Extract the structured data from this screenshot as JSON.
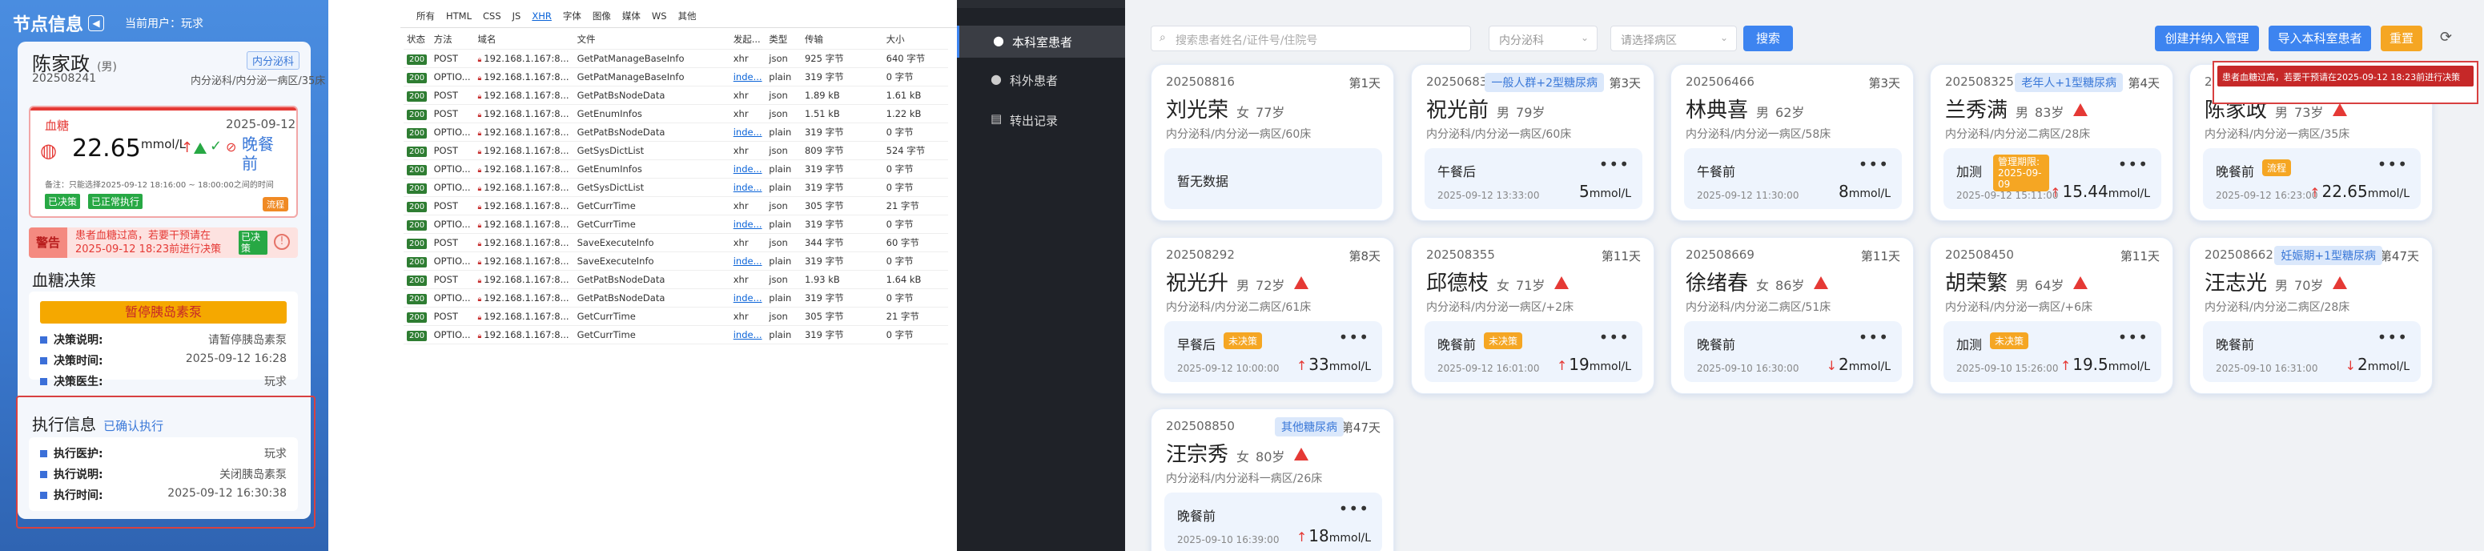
{
  "panelA": {
    "title": "节点信息",
    "current_user": "当前用户：玩求",
    "patient_name": "陈家政",
    "patient_sex": "(男)",
    "dept_tag": "内分泌科",
    "patient_code": "202508241",
    "patient_loc": "内分泌科/内分泌一病区/35床",
    "glucose_label": "血糖",
    "glucose_date": "2025-09-12",
    "glucose_value": "22.65",
    "glucose_unit": "mmol/L",
    "glucose_meal": "晚餐前",
    "glucose_note": "备注：只能选择2025-09-12 18:16:00 ~ 18:00:00之间的时间",
    "status_chip1": "已决策",
    "status_chip2": "已正常执行",
    "flow_button": "流程",
    "alert_label": "警告",
    "alert_text": "患者血糖过高，若要干预请在2025-09-12 18:23前进行决策",
    "alert_chip": "已决策",
    "decision_title": "血糖决策",
    "decision_banner": "暂停胰岛素泵",
    "decision_rows": [
      {
        "label": "决策说明:",
        "value": "请暂停胰岛素泵"
      },
      {
        "label": "决策时间:",
        "value": "2025-09-12 16:28"
      },
      {
        "label": "决策医生:",
        "value": "玩求"
      }
    ],
    "exec_title": "执行信息",
    "exec_link": "已确认执行",
    "exec_rows": [
      {
        "label": "执行医护:",
        "value": "玩求"
      },
      {
        "label": "执行说明:",
        "value": "关闭胰岛素泵"
      },
      {
        "label": "执行时间:",
        "value": "2025-09-12 16:30:38"
      }
    ]
  },
  "devtools": {
    "tabs": [
      "所有",
      "HTML",
      "CSS",
      "JS",
      "XHR",
      "字体",
      "图像",
      "媒体",
      "WS",
      "其他"
    ],
    "headers": [
      "状态",
      "方法",
      "域名",
      "文件",
      "发起...",
      "类型",
      "传输",
      "大小"
    ],
    "rows": [
      [
        "200",
        "POST",
        "192.168.1.167:8...",
        "GetPatManageBaseInfo",
        "xhr",
        "json",
        "925 字节",
        "640 字节"
      ],
      [
        "200",
        "OPTIO...",
        "192.168.1.167:8...",
        "GetPatManageBaseInfo",
        "inde...",
        "plain",
        "319 字节",
        "0 字节"
      ],
      [
        "200",
        "POST",
        "192.168.1.167:8...",
        "GetPatBsNodeData",
        "xhr",
        "json",
        "1.89 kB",
        "1.61 kB"
      ],
      [
        "200",
        "POST",
        "192.168.1.167:8...",
        "GetEnumInfos",
        "xhr",
        "json",
        "1.51 kB",
        "1.22 kB"
      ],
      [
        "200",
        "OPTIO...",
        "192.168.1.167:8...",
        "GetPatBsNodeData",
        "inde...",
        "plain",
        "319 字节",
        "0 字节"
      ],
      [
        "200",
        "POST",
        "192.168.1.167:8...",
        "GetSysDictList",
        "xhr",
        "json",
        "809 字节",
        "524 字节"
      ],
      [
        "200",
        "OPTIO...",
        "192.168.1.167:8...",
        "GetEnumInfos",
        "inde...",
        "plain",
        "319 字节",
        "0 字节"
      ],
      [
        "200",
        "OPTIO...",
        "192.168.1.167:8...",
        "GetSysDictList",
        "inde...",
        "plain",
        "319 字节",
        "0 字节"
      ],
      [
        "200",
        "POST",
        "192.168.1.167:8...",
        "GetCurrTime",
        "xhr",
        "json",
        "305 字节",
        "21 字节"
      ],
      [
        "200",
        "OPTIO...",
        "192.168.1.167:8...",
        "GetCurrTime",
        "inde...",
        "plain",
        "319 字节",
        "0 字节"
      ],
      [
        "200",
        "POST",
        "192.168.1.167:8...",
        "SaveExecuteInfo",
        "xhr",
        "json",
        "344 字节",
        "60 字节"
      ],
      [
        "200",
        "OPTIO...",
        "192.168.1.167:8...",
        "SaveExecuteInfo",
        "inde...",
        "plain",
        "319 字节",
        "0 字节"
      ],
      [
        "200",
        "POST",
        "192.168.1.167:8...",
        "GetPatBsNodeData",
        "xhr",
        "json",
        "1.93 kB",
        "1.64 kB"
      ],
      [
        "200",
        "OPTIO...",
        "192.168.1.167:8...",
        "GetPatBsNodeData",
        "inde...",
        "plain",
        "319 字节",
        "0 字节"
      ],
      [
        "200",
        "POST",
        "192.168.1.167:8...",
        "GetCurrTime",
        "xhr",
        "json",
        "305 字节",
        "21 字节"
      ],
      [
        "200",
        "OPTIO...",
        "192.168.1.167:8...",
        "GetCurrTime",
        "inde...",
        "plain",
        "319 字节",
        "0 字节"
      ]
    ]
  },
  "nav": {
    "items": [
      "本科室患者",
      "科外患者",
      "转出记录"
    ]
  },
  "toolbar": {
    "search_placeholder": "搜索患者姓名/证件号/住院号",
    "dept_select": "内分泌科",
    "ward_placeholder": "请选择病区",
    "search_btn": "搜索",
    "create_btn": "创建并纳入管理",
    "import_btn": "导入本科室患者",
    "reset_btn": "重置"
  },
  "toast": "患者血糖过高，若要干预请在2025-09-12 18:23前进行决策",
  "cards": [
    {
      "code": "202508816",
      "days": "第1天",
      "tag": "",
      "name": "刘光荣",
      "sex": "女",
      "age": "77岁",
      "warn": false,
      "loc": "内分泌科/内分泌一病区/60床",
      "empty": "暂无数据"
    },
    {
      "code": "202506831",
      "days": "第3天",
      "tag": "一般人群+2型糖尿病",
      "name": "祝光前",
      "sex": "男",
      "age": "79岁",
      "warn": false,
      "loc": "内分泌科/内分泌一病区/60床",
      "meal": "午餐后",
      "time": "2025-09-12 13:33:00",
      "value": "5",
      "dir": "",
      "badge": ""
    },
    {
      "code": "202506466",
      "days": "第3天",
      "tag": "",
      "name": "林典喜",
      "sex": "男",
      "age": "62岁",
      "warn": false,
      "loc": "内分泌科/内分泌一病区/58床",
      "meal": "午餐前",
      "time": "2025-09-12 11:30:00",
      "value": "8",
      "dir": "",
      "badge": ""
    },
    {
      "code": "202508325",
      "days": "第4天",
      "tag": "老年人+1型糖尿病",
      "name": "兰秀满",
      "sex": "男",
      "age": "83岁",
      "warn": true,
      "loc": "内分泌科/内分泌二病区/28床",
      "meal": "加测",
      "time": "2025-09-12 15:11:00",
      "value": "15.44",
      "dir": "up",
      "badge": "管理期限: 2025-09-09"
    },
    {
      "code": "202508241",
      "days": "第4天",
      "tag": "",
      "name": "陈家政",
      "sex": "男",
      "age": "73岁",
      "warn": true,
      "loc": "内分泌科/内分泌一病区/35床",
      "meal": "晚餐前",
      "time": "2025-09-12 16:23:00",
      "value": "22.65",
      "dir": "up",
      "badge": "流程"
    },
    {
      "code": "202508292",
      "days": "第8天",
      "tag": "",
      "name": "祝光升",
      "sex": "男",
      "age": "72岁",
      "warn": true,
      "loc": "内分泌科/内分泌二病区/61床",
      "meal": "早餐后",
      "time": "2025-09-12 10:00:00",
      "value": "33",
      "dir": "up",
      "badge": "未决策"
    },
    {
      "code": "202508355",
      "days": "第11天",
      "tag": "",
      "name": "邱德枝",
      "sex": "女",
      "age": "71岁",
      "warn": true,
      "loc": "内分泌科/内分泌一病区/+2床",
      "meal": "晚餐前",
      "time": "2025-09-12 16:01:00",
      "value": "19",
      "dir": "up",
      "badge": "未决策"
    },
    {
      "code": "202508669",
      "days": "第11天",
      "tag": "",
      "name": "徐绪春",
      "sex": "女",
      "age": "86岁",
      "warn": true,
      "loc": "内分泌科/内分泌二病区/51床",
      "meal": "晚餐前",
      "time": "2025-09-10 16:30:00",
      "value": "2",
      "dir": "down",
      "badge": ""
    },
    {
      "code": "202508450",
      "days": "第11天",
      "tag": "",
      "name": "胡荣繁",
      "sex": "男",
      "age": "64岁",
      "warn": true,
      "loc": "内分泌科/内分泌一病区/+6床",
      "meal": "加测",
      "time": "2025-09-10 15:26:00",
      "value": "19.5",
      "dir": "up",
      "badge": "未决策"
    },
    {
      "code": "202508662",
      "days": "第47天",
      "tag": "妊娠期+1型糖尿病",
      "name": "汪志光",
      "sex": "男",
      "age": "70岁",
      "warn": true,
      "loc": "内分泌科/内分泌二病区/28床",
      "meal": "晚餐前",
      "time": "2025-09-10 16:31:00",
      "value": "2",
      "dir": "down",
      "badge": ""
    },
    {
      "code": "202508850",
      "days": "第47天",
      "tag": "其他糖尿病",
      "name": "汪宗秀",
      "sex": "女",
      "age": "80岁",
      "warn": true,
      "loc": "内分泌科/内分泌科一病区/26床",
      "meal": "晚餐前",
      "time": "2025-09-10 16:39:00",
      "value": "18",
      "dir": "up",
      "badge": ""
    }
  ],
  "unit": "mmol/L",
  "colors": {
    "primary": "#3d84f0",
    "warn": "#e53935",
    "orange": "#f5a623",
    "green": "#27a844",
    "dark": "#1f2228"
  }
}
